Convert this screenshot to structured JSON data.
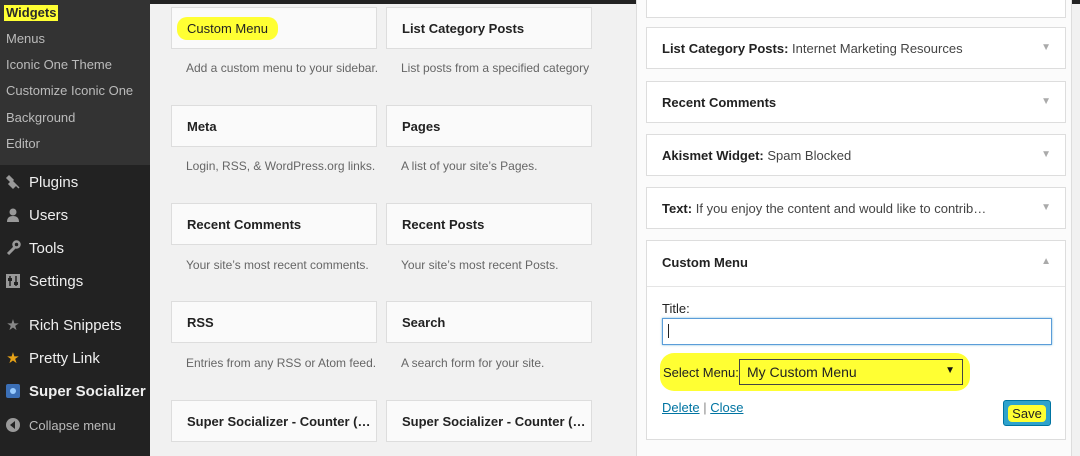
{
  "sidebar": {
    "submenu": [
      "Widgets",
      "Menus",
      "Iconic One Theme",
      "Customize Iconic One",
      "Background",
      "Editor"
    ],
    "items": [
      {
        "label": "Plugins",
        "icon": "plug-icon"
      },
      {
        "label": "Users",
        "icon": "user-icon"
      },
      {
        "label": "Tools",
        "icon": "wrench-icon"
      },
      {
        "label": "Settings",
        "icon": "settings-icon"
      },
      {
        "label": "Rich Snippets",
        "icon": "star-icon"
      },
      {
        "label": "Pretty Link",
        "icon": "star-icon"
      },
      {
        "label": "Super Socializer",
        "icon": "socializer-icon"
      },
      {
        "label": "Collapse menu",
        "icon": "collapse-icon"
      }
    ]
  },
  "widgets": [
    {
      "title": "Custom Menu",
      "desc": "Add a custom menu to your sidebar."
    },
    {
      "title": "List Category Posts",
      "desc": "List posts from a specified category"
    },
    {
      "title": "Meta",
      "desc": "Login, RSS, & WordPress.org links."
    },
    {
      "title": "Pages",
      "desc": "A list of your site’s Pages."
    },
    {
      "title": "Recent Comments",
      "desc": "Your site’s most recent comments."
    },
    {
      "title": "Recent Posts",
      "desc": "Your site’s most recent Posts."
    },
    {
      "title": "RSS",
      "desc": "Entries from any RSS or Atom feed."
    },
    {
      "title": "Search",
      "desc": "A search form for your site."
    },
    {
      "title": "Super Socializer - Counter (…",
      "desc": ""
    },
    {
      "title": "Super Socializer - Counter (…",
      "desc": ""
    }
  ],
  "area_widgets": [
    {
      "name": "List Category Posts:",
      "detail": "Internet Marketing Resources"
    },
    {
      "name": "Recent Comments",
      "detail": ""
    },
    {
      "name": "Akismet Widget:",
      "detail": "Spam Blocked"
    },
    {
      "name": "Text:",
      "detail": "If you enjoy the content and would like to contrib…"
    }
  ],
  "custom_menu_panel": {
    "title": "Custom Menu",
    "title_label": "Title:",
    "title_value": "",
    "select_label": "Select Menu:",
    "select_value": "My Custom Menu",
    "delete": "Delete",
    "separator": "|",
    "close": "Close",
    "save": "Save"
  },
  "colors": {
    "highlight": "#ffff33",
    "link": "#0074a2",
    "button": "#2ea2cc",
    "sidebar_bg": "#222222"
  }
}
